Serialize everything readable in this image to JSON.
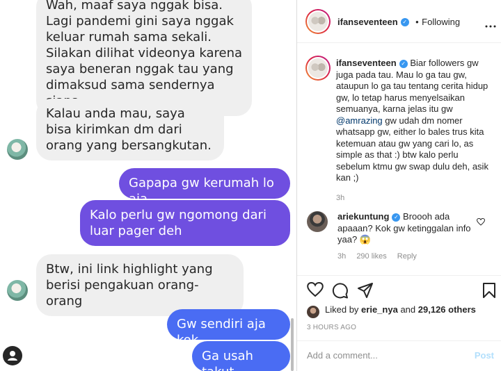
{
  "chat": {
    "messages": [
      {
        "side": "in",
        "text": "Wah, maaf saya nggak bisa. Lagi pandemi gini saya nggak keluar rumah sama sekali. Silakan dilihat videonya karena saya beneran nggak tau yang dimaksud sama sendernya siapa."
      },
      {
        "side": "in",
        "text": "Kalau anda mau, saya bisa kirimkan dm dari orang yang bersangkutan."
      },
      {
        "side": "out",
        "text": "Gapapa gw kerumah lo aja"
      },
      {
        "side": "out",
        "text": "Kalo perlu gw ngomong dari luar pager deh"
      },
      {
        "side": "in",
        "text": "Btw, ini link highlight yang berisi pengakuan orang-orang"
      },
      {
        "side": "out",
        "text": "Gw sendiri aja kok"
      },
      {
        "side": "out",
        "text": "Ga usah takut"
      }
    ]
  },
  "post": {
    "header": {
      "username": "ifanseventeen",
      "separator": "•",
      "follow_status": "Following",
      "more_icon": "more-horizontal-icon"
    },
    "caption": {
      "username": "ifanseventeen",
      "text_before_mention": "Biar followers gw juga pada tau. Mau lo ga tau gw, ataupun lo ga tau tentang cerita hidup gw, lo tetap harus menyelsaikan semuanya, karna jelas itu gw",
      "mention": "@amrazing",
      "text_after_mention": "gw udah dm nomer whatsapp gw, either lo bales trus kita ketemuan atau gw yang cari lo, as simple as that :) btw kalo perlu sebelum ktmu gw swap dulu deh, asik kan ;)",
      "time": "3h"
    },
    "comment": {
      "username": "ariekuntung",
      "text": "Broooh ada apaaan? Kok gw ketinggalan info yaa? 😱",
      "time": "3h",
      "likes": "290 likes",
      "reply": "Reply"
    },
    "likes": {
      "prefix": "Liked by",
      "user": "erie_nya",
      "and": "and",
      "count": "29,126 others"
    },
    "timestamp": "3 HOURS AGO",
    "add_comment_placeholder": "Add a comment...",
    "post_button": "Post",
    "colors": {
      "link": "#00376b",
      "verified": "#3897f0",
      "post_disabled": "#b2dffc",
      "bubble_violet": "#6f4fe0",
      "bubble_blue": "#4a6cf3"
    }
  }
}
